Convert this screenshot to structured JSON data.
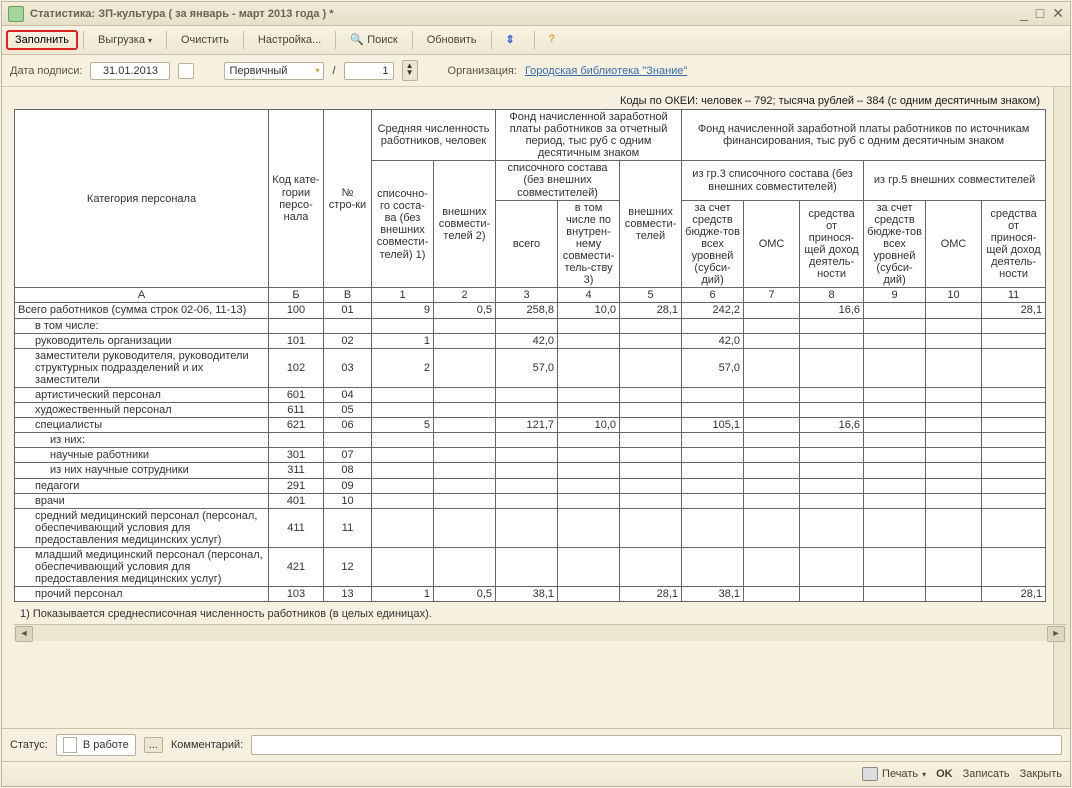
{
  "window": {
    "title": "Статистика: ЗП-культура ( за январь - март 2013 года ) *"
  },
  "toolbar": {
    "fill": "Заполнить",
    "export": "Выгрузка",
    "clear": "Очистить",
    "settings": "Настройка...",
    "search": "Поиск",
    "refresh": "Обновить"
  },
  "params": {
    "date_label": "Дата подписи:",
    "date_value": "31.01.2013",
    "kind_value": "Первичный",
    "slash": "/",
    "num_value": "1",
    "org_label": "Организация:",
    "org_value": "Городская библиотека \"Знание\""
  },
  "okei_line": "Коды по ОКЕИ: человек – 792; тысяча рублей – 384 (с одним десятичным знаком)",
  "headers": {
    "cat": "Категория персонала",
    "code": "Код кате-гории персо-нала",
    "row": "№ стро-ки",
    "avg": "Средняя численность работников, человек",
    "fund": "Фонд начисленной заработной платы работников за отчетный период, тыс руб с одним десятичным знаком",
    "fund_src": "Фонд начисленной заработной платы работников по источникам финансирования, тыс руб с одним десятичным знаком",
    "col1": "списочно-го соста-ва (без внешних совмести-телей) 1)",
    "col2": "внешних совмести-телей 2)",
    "col3_4": "списочного состава (без внешних совместителей)",
    "col5": "внешних совмести-телей",
    "col6_8": "из гр.3 списочного состава (без внешних совместителей)",
    "col9_11": "из гр.5 внешних совместителей",
    "col3": "всего",
    "col4": "в том числе по внутрен-нему совмести-тель-ству 3)",
    "col6": "за счет средств бюдже-тов всех уровней (субси-дий)",
    "col7": "ОМС",
    "col8": "средства от принося-щей доход деятель-ности",
    "col9": "за счет средств бюдже-тов всех уровней (субси-дий)",
    "col10": "ОМС",
    "col11": "средства от принося-щей доход деятель-ности",
    "hA": "А",
    "hB": "Б",
    "hV": "В",
    "h1": "1",
    "h2": "2",
    "h3": "3",
    "h4": "4",
    "h5": "5",
    "h6": "6",
    "h7": "7",
    "h8": "8",
    "h9": "9",
    "h10": "10",
    "h11": "11"
  },
  "rows": [
    {
      "label": "Всего работников\n(сумма строк 02-06, 11-13)",
      "ind": "",
      "code": "100",
      "num": "01",
      "c1": "9",
      "c2": "0,5",
      "c3": "258,8",
      "c4": "10,0",
      "c5": "28,1",
      "c6": "242,2",
      "c7": "",
      "c8": "16,6",
      "c9": "",
      "c10": "",
      "c11": "28,1"
    },
    {
      "label": "в том числе:",
      "ind": "ind1",
      "code": "",
      "num": "",
      "c1": "",
      "c2": "",
      "c3": "",
      "c4": "",
      "c5": "",
      "c6": "",
      "c7": "",
      "c8": "",
      "c9": "",
      "c10": "",
      "c11": ""
    },
    {
      "label": "руководитель организации",
      "ind": "ind1",
      "code": "101",
      "num": "02",
      "c1": "1",
      "c2": "",
      "c3": "42,0",
      "c4": "",
      "c5": "",
      "c6": "42,0",
      "c7": "",
      "c8": "",
      "c9": "",
      "c10": "",
      "c11": ""
    },
    {
      "label": "заместители руководителя, руководители структурных подразделений и их заместители",
      "ind": "ind1",
      "code": "102",
      "num": "03",
      "c1": "2",
      "c2": "",
      "c3": "57,0",
      "c4": "",
      "c5": "",
      "c6": "57,0",
      "c7": "",
      "c8": "",
      "c9": "",
      "c10": "",
      "c11": ""
    },
    {
      "label": "артистический персонал",
      "ind": "ind1",
      "code": "601",
      "num": "04",
      "c1": "",
      "c2": "",
      "c3": "",
      "c4": "",
      "c5": "",
      "c6": "",
      "c7": "",
      "c8": "",
      "c9": "",
      "c10": "",
      "c11": ""
    },
    {
      "label": "художественный персонал",
      "ind": "ind1",
      "code": "611",
      "num": "05",
      "c1": "",
      "c2": "",
      "c3": "",
      "c4": "",
      "c5": "",
      "c6": "",
      "c7": "",
      "c8": "",
      "c9": "",
      "c10": "",
      "c11": ""
    },
    {
      "label": "специалисты",
      "ind": "ind1",
      "code": "621",
      "num": "06",
      "c1": "5",
      "c2": "",
      "c3": "121,7",
      "c4": "10,0",
      "c5": "",
      "c6": "105,1",
      "c7": "",
      "c8": "16,6",
      "c9": "",
      "c10": "",
      "c11": ""
    },
    {
      "label": "из них:",
      "ind": "ind2",
      "code": "",
      "num": "",
      "c1": "",
      "c2": "",
      "c3": "",
      "c4": "",
      "c5": "",
      "c6": "",
      "c7": "",
      "c8": "",
      "c9": "",
      "c10": "",
      "c11": ""
    },
    {
      "label": "научные работники",
      "ind": "ind2",
      "code": "301",
      "num": "07",
      "c1": "",
      "c2": "",
      "c3": "",
      "c4": "",
      "c5": "",
      "c6": "",
      "c7": "",
      "c8": "",
      "c9": "",
      "c10": "",
      "c11": ""
    },
    {
      "label": "из них научные сотрудники",
      "ind": "ind2",
      "code": "311",
      "num": "08",
      "c1": "",
      "c2": "",
      "c3": "",
      "c4": "",
      "c5": "",
      "c6": "",
      "c7": "",
      "c8": "",
      "c9": "",
      "c10": "",
      "c11": ""
    },
    {
      "label": "педагоги",
      "ind": "ind1",
      "code": "291",
      "num": "09",
      "c1": "",
      "c2": "",
      "c3": "",
      "c4": "",
      "c5": "",
      "c6": "",
      "c7": "",
      "c8": "",
      "c9": "",
      "c10": "",
      "c11": ""
    },
    {
      "label": "врачи",
      "ind": "ind1",
      "code": "401",
      "num": "10",
      "c1": "",
      "c2": "",
      "c3": "",
      "c4": "",
      "c5": "",
      "c6": "",
      "c7": "",
      "c8": "",
      "c9": "",
      "c10": "",
      "c11": ""
    },
    {
      "label": "средний медицинский персонал (персонал, обеспечивающий условия для предоставления медицинских услуг)",
      "ind": "ind1",
      "code": "411",
      "num": "11",
      "c1": "",
      "c2": "",
      "c3": "",
      "c4": "",
      "c5": "",
      "c6": "",
      "c7": "",
      "c8": "",
      "c9": "",
      "c10": "",
      "c11": ""
    },
    {
      "label": "младший медицинский персонал (персонал, обеспечивающий условия для предоставления медицинских услуг)",
      "ind": "ind1",
      "code": "421",
      "num": "12",
      "c1": "",
      "c2": "",
      "c3": "",
      "c4": "",
      "c5": "",
      "c6": "",
      "c7": "",
      "c8": "",
      "c9": "",
      "c10": "",
      "c11": ""
    },
    {
      "label": "прочий персонал",
      "ind": "ind1",
      "code": "103",
      "num": "13",
      "c1": "1",
      "c2": "0,5",
      "c3": "38,1",
      "c4": "",
      "c5": "28,1",
      "c6": "38,1",
      "c7": "",
      "c8": "",
      "c9": "",
      "c10": "",
      "c11": "28,1"
    }
  ],
  "green_cols_for_coded_rows": [
    "c1",
    "c2",
    "c3",
    "c4",
    "c5",
    "c6",
    "c7",
    "c8",
    "c9",
    "c10",
    "c11"
  ],
  "footnote": "1) Показывается среднесписочная численность работников (в целых единицах).",
  "status": {
    "label": "Статус:",
    "value": "В работе",
    "comment_label": "Комментарий:"
  },
  "bottom": {
    "print": "Печать",
    "ok": "OK",
    "save": "Записать",
    "close": "Закрыть"
  }
}
